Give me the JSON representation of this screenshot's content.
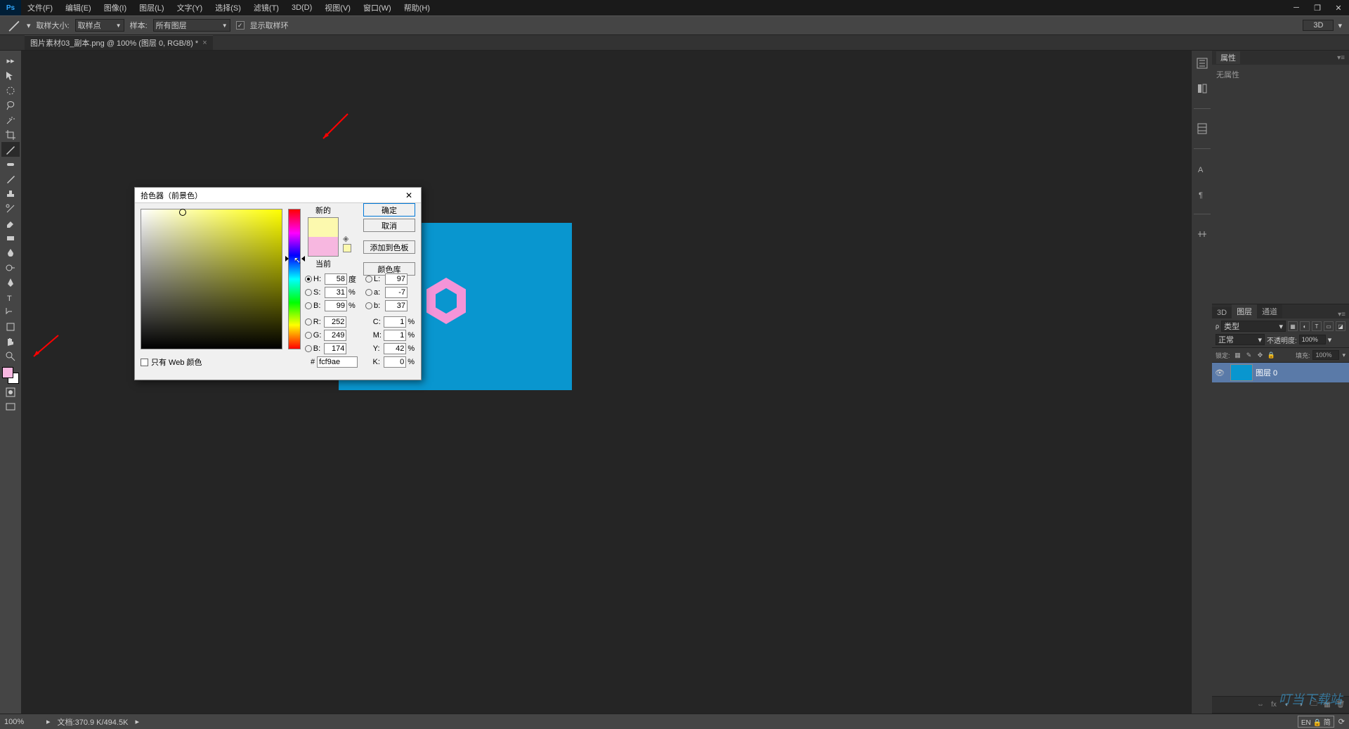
{
  "app": {
    "logo": "Ps"
  },
  "menu": [
    "文件(F)",
    "编辑(E)",
    "图像(I)",
    "图层(L)",
    "文字(Y)",
    "选择(S)",
    "滤镜(T)",
    "3D(D)",
    "视图(V)",
    "窗口(W)",
    "帮助(H)"
  ],
  "options": {
    "sample_size_label": "取样大小:",
    "sample_size_value": "取样点",
    "sample_label": "样本:",
    "sample_value": "所有图层",
    "checkbox_label": "显示取样环",
    "mode_button": "3D"
  },
  "doc_tab": {
    "title": "图片素材03_副本.png @ 100% (图层 0, RGB/8) *"
  },
  "properties_panel": {
    "title": "属性",
    "content": "无属性"
  },
  "layers_panel": {
    "tabs": [
      "3D",
      "图层",
      "通道"
    ],
    "active_tab": 1,
    "kind_label": "类型",
    "blend_mode": "正常",
    "opacity_label": "不透明度:",
    "opacity_value": "100%",
    "lock_label": "锁定:",
    "fill_label": "填充:",
    "fill_value": "100%",
    "layers": [
      {
        "name": "图层 0",
        "visible": true
      }
    ]
  },
  "status": {
    "zoom": "100%",
    "doc_info": "文档:370.9 K/494.5K",
    "ime": "EN 🔒 简"
  },
  "color_picker": {
    "title": "拾色器（前景色）",
    "new_label": "新的",
    "current_label": "当前",
    "ok": "确定",
    "cancel": "取消",
    "add_swatch": "添加到色板",
    "color_lib": "颜色库",
    "web_only": "只有 Web 颜色",
    "hex_label": "#",
    "hex_value": "fcf9ae",
    "H": "58",
    "H_unit": "度",
    "S": "31",
    "S_unit": "%",
    "Bv": "99",
    "Bv_unit": "%",
    "R": "252",
    "G": "249",
    "B": "174",
    "L": "97",
    "a": "-7",
    "b_lab": "37",
    "C": "1",
    "M": "1",
    "Y": "42",
    "K": "0",
    "pct": "%"
  },
  "watermark": "叮当下载站"
}
